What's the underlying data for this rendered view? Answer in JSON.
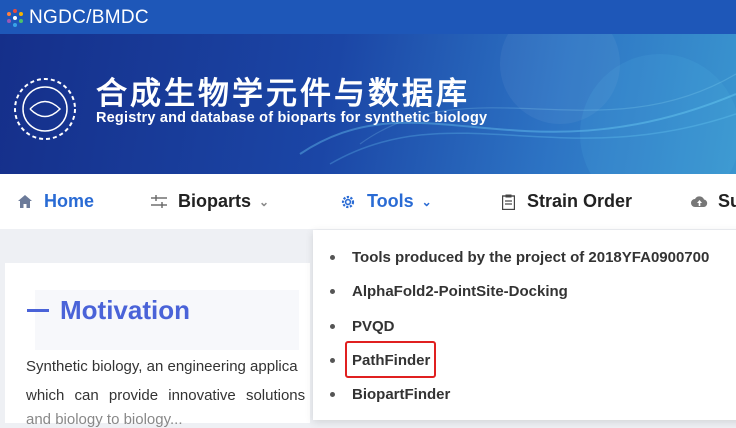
{
  "topbar": {
    "site_name": "NGDC/BMDC",
    "logo_icon": "molecule-dots-icon"
  },
  "banner": {
    "title_cn": "合成生物学元件与数据库",
    "title_en": "Registry and database of bioparts for synthetic biology",
    "emblem_icon": "dna-ring-icon"
  },
  "nav": {
    "items": [
      {
        "label": "Home",
        "icon": "home-icon"
      },
      {
        "label": "Bioparts",
        "icon": "sliders-icon"
      },
      {
        "label": "Tools",
        "icon": "gear-icon"
      },
      {
        "label": "Strain Order",
        "icon": "clipboard-icon"
      },
      {
        "label": "Su",
        "icon": "cloud-upload-icon"
      }
    ]
  },
  "content": {
    "heading": "Motivation",
    "lines": [
      "Synthetic biology, an engineering applica",
      "which can provide innovative solutions",
      "and biology to biology..."
    ]
  },
  "tools_menu": {
    "items": [
      "Tools produced by the project of 2018YFA0900700",
      "AlphaFold2-PointSite-Docking",
      "PVQD",
      "PathFinder",
      "BiopartFinder"
    ],
    "highlighted": "PathFinder"
  },
  "colors": {
    "brand_blue": "#1e57b8",
    "active_nav": "#2a6bd4",
    "heading": "#4a63d8",
    "highlight": "#e02020"
  }
}
